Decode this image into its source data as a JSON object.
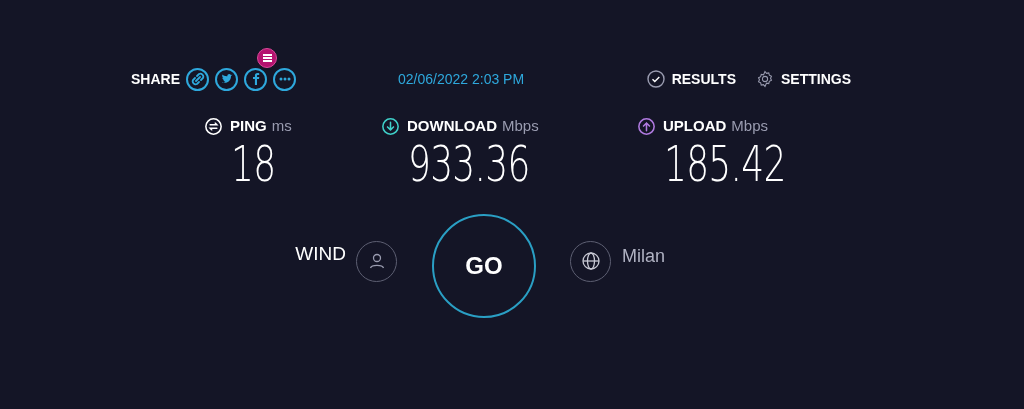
{
  "header": {
    "share_label": "SHARE",
    "share_buttons": [
      {
        "kind": "link"
      },
      {
        "kind": "twitter"
      },
      {
        "kind": "facebook"
      },
      {
        "kind": "more"
      }
    ],
    "date": "02/06/2022 2:03 PM",
    "results": "RESULTS",
    "settings": "SETTINGS"
  },
  "metrics": [
    {
      "kind": "ping",
      "label": "PING",
      "unit": "ms",
      "value": "18"
    },
    {
      "kind": "download",
      "label": "DOWNLOAD",
      "unit": "Mbps",
      "value": "933.36"
    },
    {
      "kind": "upload",
      "label": "UPLOAD",
      "unit": "Mbps",
      "value": "185.42"
    }
  ],
  "provider": "WIND",
  "go": "GO",
  "server": "Milan"
}
